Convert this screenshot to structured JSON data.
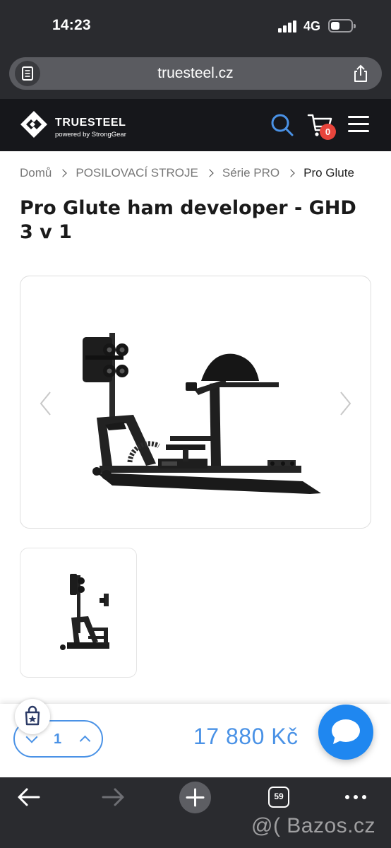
{
  "status_bar": {
    "time": "14:23",
    "network": "4G"
  },
  "browser": {
    "url": "truesteel.cz",
    "tabs_count": "59",
    "icons": {
      "reader": "reader-icon",
      "share": "share-icon",
      "back": "arrow-left-icon",
      "forward": "arrow-right-icon",
      "new_tab": "plus-icon",
      "more": "more-icon"
    }
  },
  "site_header": {
    "brand_name": "TRUESTEEL",
    "brand_sub": "powered by StrongGear",
    "cart_count": "0",
    "icons": {
      "search": "search-icon",
      "cart": "cart-icon",
      "menu": "hamburger-menu-icon"
    }
  },
  "breadcrumb": [
    "Domů",
    "POSILOVACÍ STROJE",
    "Série PRO",
    "Pro Glute"
  ],
  "product": {
    "title": "Pro Glute ham developer - GHD 3 v 1",
    "price": "17 880 Kč",
    "quantity": "1"
  },
  "watermark": "@( Bazos.cz",
  "colors": {
    "accent": "#4a92e6",
    "chat": "#1f87f0",
    "badge": "#e8453c",
    "header_bg": "#16171b",
    "chrome_bg": "#2a2b2f"
  }
}
